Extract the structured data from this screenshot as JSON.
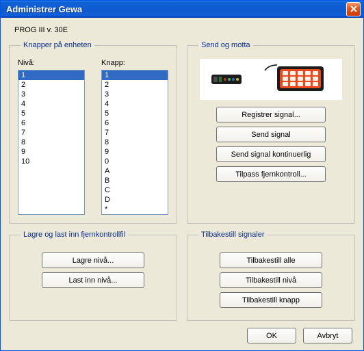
{
  "title": "Administrer Gewa",
  "version": "PROG III v. 30E",
  "groups": {
    "knapper_legend": "Knapper på enheten",
    "niva_label": "Nivå:",
    "knapp_label": "Knapp:",
    "send_legend": "Send og motta",
    "file_legend": "Lagre og last inn fjernkontrollfil",
    "reset_legend": "Tilbakestill signaler"
  },
  "niva_items": [
    "1",
    "2",
    "3",
    "4",
    "5",
    "6",
    "7",
    "8",
    "9",
    "10"
  ],
  "niva_selected": 0,
  "knapp_items": [
    "1",
    "2",
    "3",
    "4",
    "5",
    "6",
    "7",
    "8",
    "9",
    "0",
    "A",
    "B",
    "C",
    "D",
    "*",
    "#"
  ],
  "knapp_selected": 0,
  "buttons": {
    "registrer": "Registrer signal...",
    "send": "Send signal",
    "send_cont": "Send signal kontinuerlig",
    "tilpass": "Tilpass fjernkontroll...",
    "lagre": "Lagre nivå...",
    "lastinn": "Last inn nivå...",
    "reset_alle": "Tilbakestill alle",
    "reset_niva": "Tilbakestill nivå",
    "reset_knapp": "Tilbakestill knapp"
  },
  "footer": {
    "ok": "OK",
    "avbryt": "Avbryt"
  }
}
